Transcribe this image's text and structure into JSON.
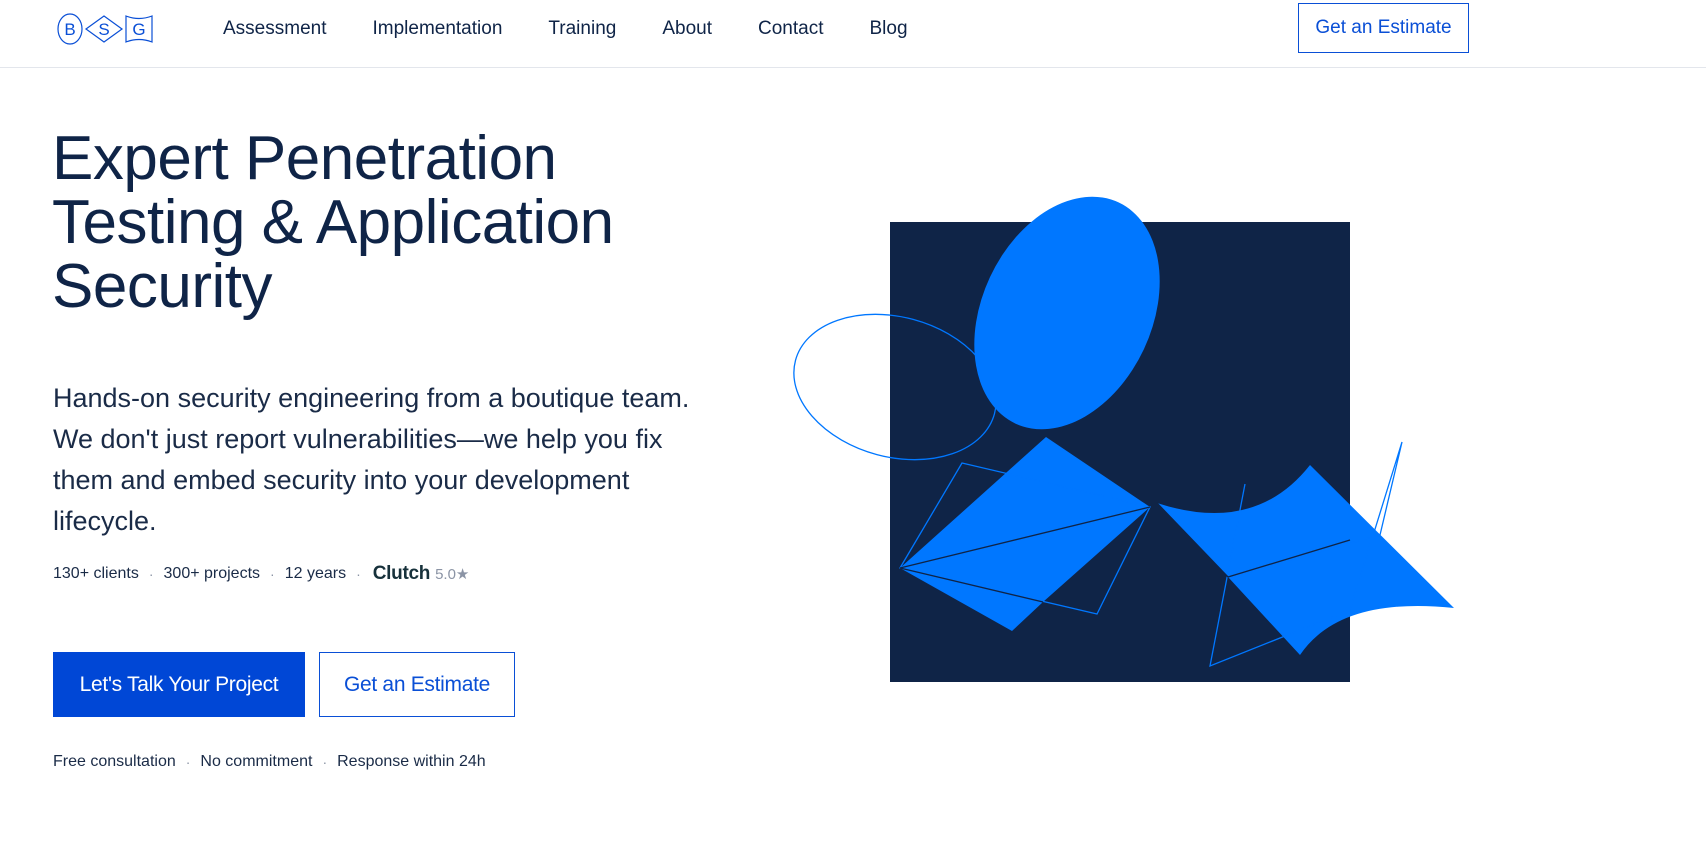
{
  "header": {
    "logo_letters": [
      "B",
      "S",
      "G"
    ],
    "nav": [
      {
        "label": "Assessment"
      },
      {
        "label": "Implementation"
      },
      {
        "label": "Training"
      },
      {
        "label": "About"
      },
      {
        "label": "Contact"
      },
      {
        "label": "Blog"
      }
    ],
    "cta_label": "Get an Estimate"
  },
  "hero": {
    "title_lines": [
      "Expert Penetration",
      "Testing & Application",
      "Security"
    ],
    "subtitle_lines": [
      "Hands-on security engineering from a boutique team.",
      "We don't just report vulnerabilities—we help you fix",
      "them and embed security into your development",
      "lifecycle."
    ],
    "stats": {
      "clients": "130+ clients",
      "projects": "300+ projects",
      "years": "12 years",
      "clutch_logo": "Clutch",
      "clutch_rating": "5.0★"
    },
    "primary_button": "Let's Talk Your Project",
    "secondary_button": "Get an Estimate",
    "footnotes": [
      "Free consultation",
      "No commitment",
      "Response within 24h"
    ]
  },
  "colors": {
    "navy": "#0f2447",
    "accent_blue": "#0077ff",
    "button_blue": "#0047d6",
    "outline_blue": "#0a4fd6"
  }
}
